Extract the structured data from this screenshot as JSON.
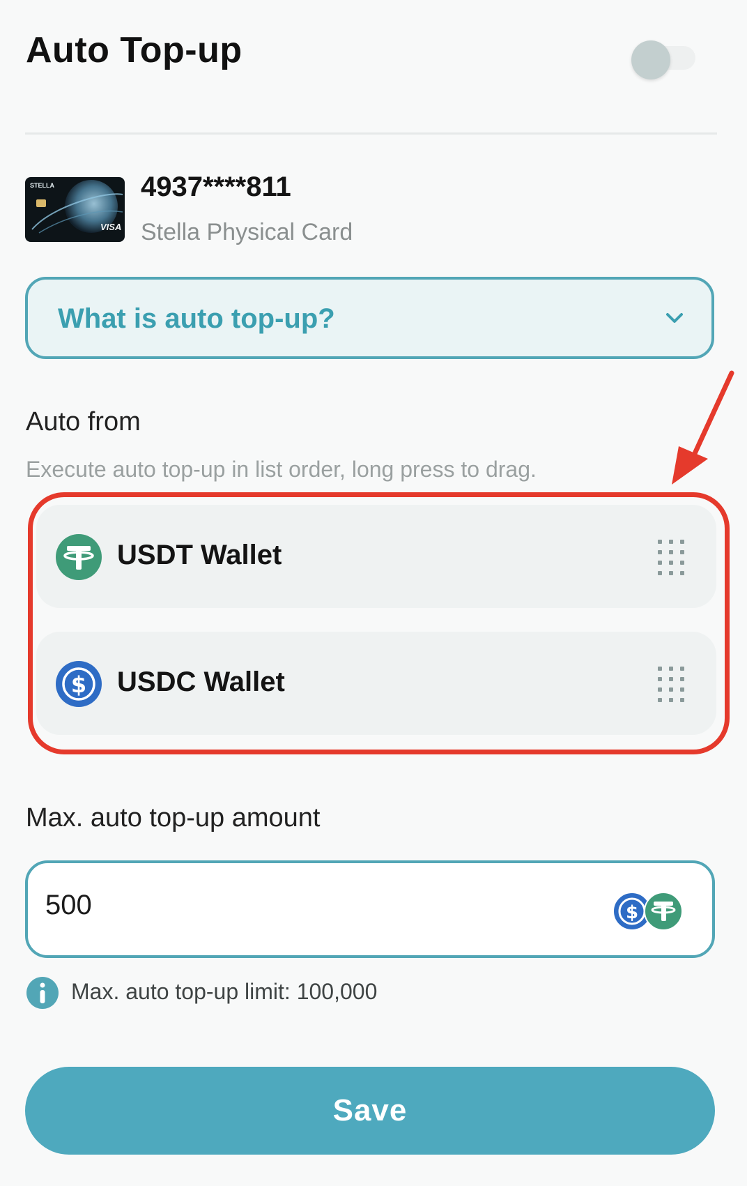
{
  "header": {
    "title": "Auto Top-up",
    "toggle_state": "off"
  },
  "card": {
    "number": "4937****811",
    "name": "Stella Physical Card",
    "image_brand_text": "STELLA",
    "image_network_text": "VISA"
  },
  "faq": {
    "label": "What is auto top-up?",
    "icon": "chevron-down-icon"
  },
  "auto_from": {
    "title": "Auto from",
    "hint": "Execute auto top-up in list order, long press to drag.",
    "wallets": [
      {
        "label": "USDT Wallet",
        "icon": "usdt-icon",
        "color": "#3f9b78"
      },
      {
        "label": "USDC Wallet",
        "icon": "usdc-icon",
        "color": "#2e6cc5"
      }
    ]
  },
  "max_amount": {
    "title": "Max. auto top-up amount",
    "value": "500",
    "limit_text": "Max. auto top-up limit: 100,000"
  },
  "actions": {
    "save_label": "Save"
  },
  "colors": {
    "accent": "#52a6b6",
    "save_button": "#4ea9be",
    "highlight": "#e53a2c",
    "usdt": "#3f9b78",
    "usdc": "#2e6cc5"
  }
}
